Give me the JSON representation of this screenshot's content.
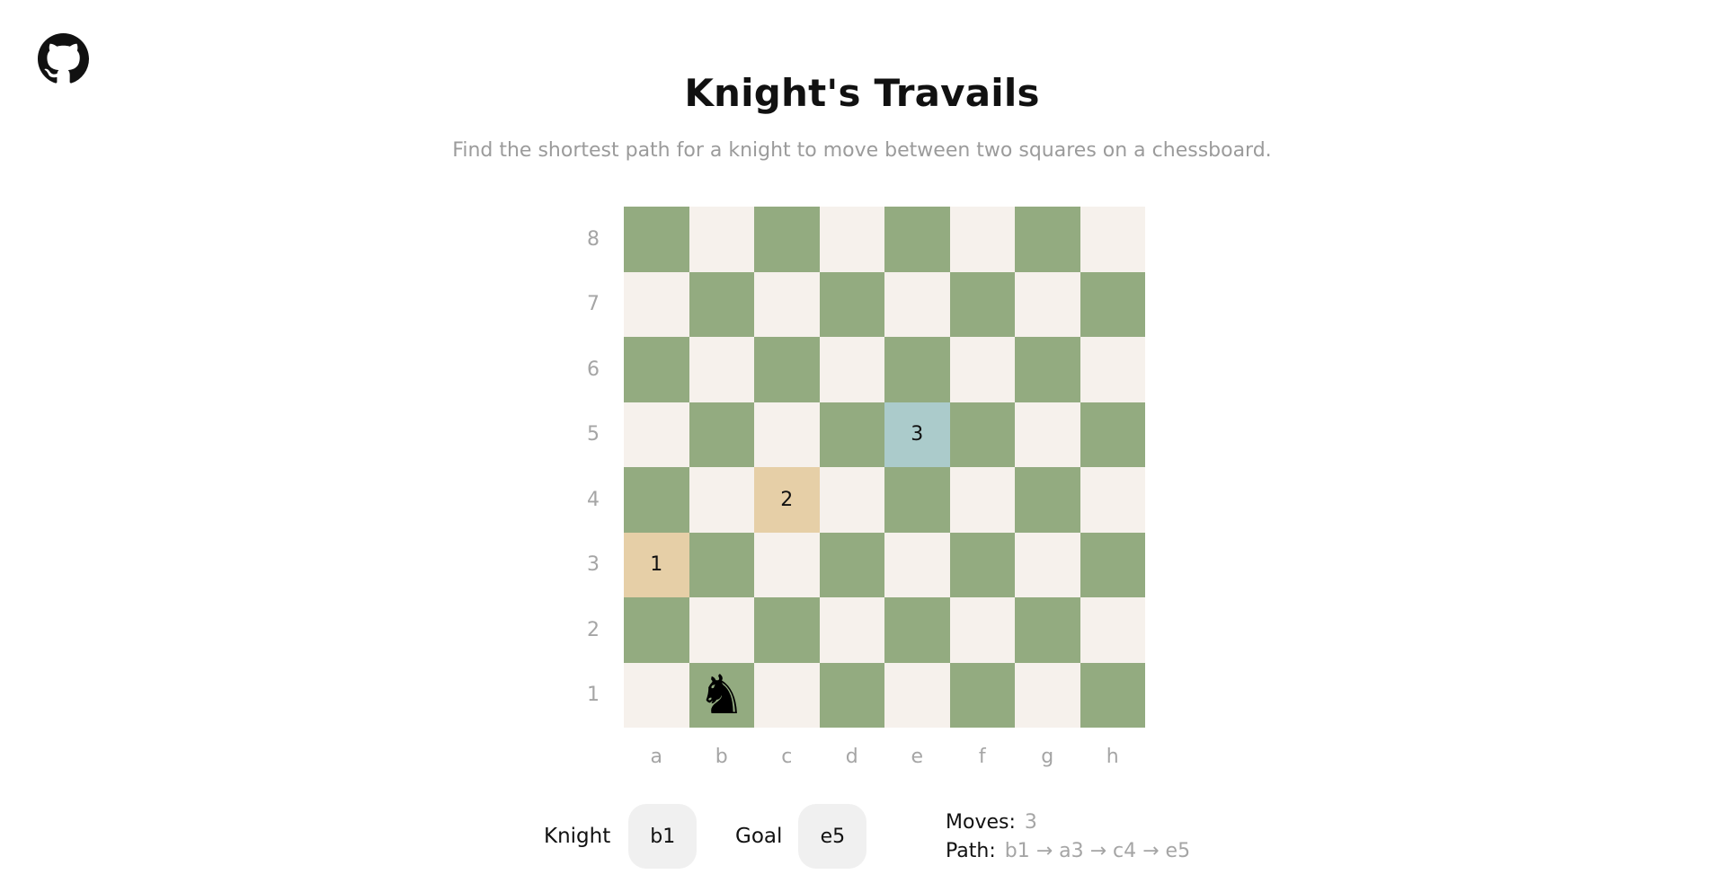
{
  "header": {
    "github_icon": "github-icon",
    "title": "Knight's Travails",
    "subtitle": "Find the shortest path for a knight to move between two squares on a chessboard."
  },
  "board": {
    "ranks": [
      "8",
      "7",
      "6",
      "5",
      "4",
      "3",
      "2",
      "1"
    ],
    "files": [
      "a",
      "b",
      "c",
      "d",
      "e",
      "f",
      "g",
      "h"
    ],
    "colors": {
      "dark": "#93ab80",
      "light": "#f6f1ec",
      "path": "#e6cfa7",
      "goal": "#abcbcb"
    },
    "knight_square": "b1",
    "knight_glyph": "♞",
    "path_steps": [
      {
        "square": "a3",
        "label": "1",
        "kind": "path"
      },
      {
        "square": "c4",
        "label": "2",
        "kind": "path"
      },
      {
        "square": "e5",
        "label": "3",
        "kind": "goal"
      }
    ]
  },
  "controls": {
    "knight_label": "Knight",
    "knight_value": "b1",
    "goal_label": "Goal",
    "goal_value": "e5"
  },
  "result": {
    "moves_label": "Moves:",
    "moves_value": "3",
    "path_label": "Path:",
    "path_value": "b1 → a3 → c4 → e5"
  }
}
